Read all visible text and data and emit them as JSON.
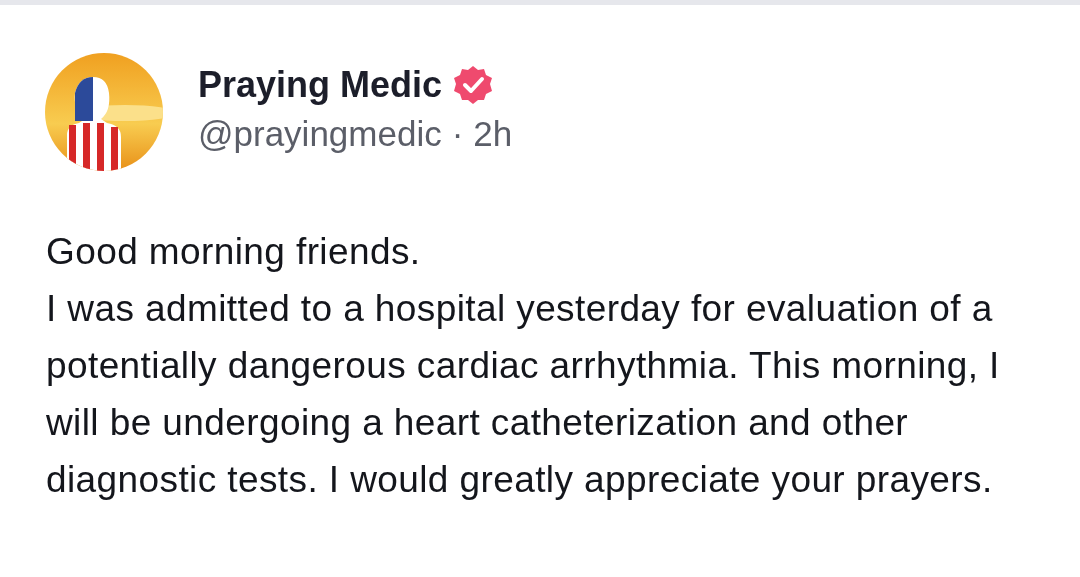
{
  "post": {
    "author": {
      "name": "Praying Medic",
      "verified": true,
      "handle": "@prayingmedic"
    },
    "separator": "·",
    "time": "2h",
    "paragraphs": [
      "Good morning friends.",
      "I was admitted to a hospital yesterday for evaluation of a potentially dangerous cardiac arrhythmia. This morning, I will be undergoing a heart catheterization and other diagnostic tests. I would greatly appreciate your prayers."
    ]
  }
}
